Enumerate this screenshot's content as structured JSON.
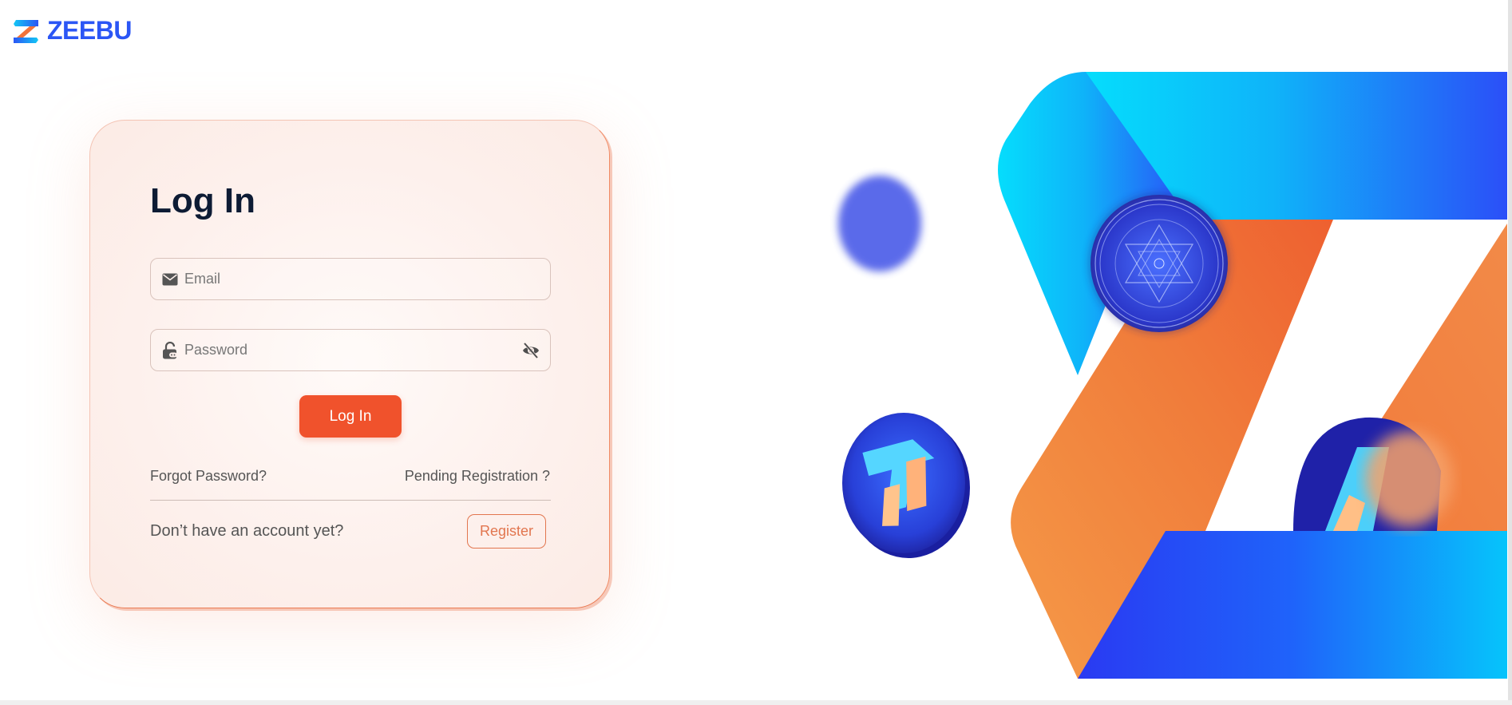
{
  "brand": {
    "name": "ZEEBU",
    "color": "#2b56f5",
    "logo_icon": "zeebu-z-logo"
  },
  "login": {
    "title": "Log In",
    "email_placeholder": "Email",
    "password_placeholder": "Password",
    "email_icon": "envelope-icon",
    "password_icon": "lock-icon",
    "visibility_icon": "eye-off-icon",
    "submit_label": "Log In",
    "forgot_label": "Forgot Password?",
    "pending_label": "Pending Registration ?",
    "no_account_text": "Don’t have an account yet?",
    "register_label": "Register"
  },
  "colors": {
    "accent": "#f0522c",
    "title": "#0d1b34",
    "register": "#e2764f",
    "cyan": "#05d6fb",
    "blue": "#2753f7",
    "orange": "#f2733a"
  }
}
